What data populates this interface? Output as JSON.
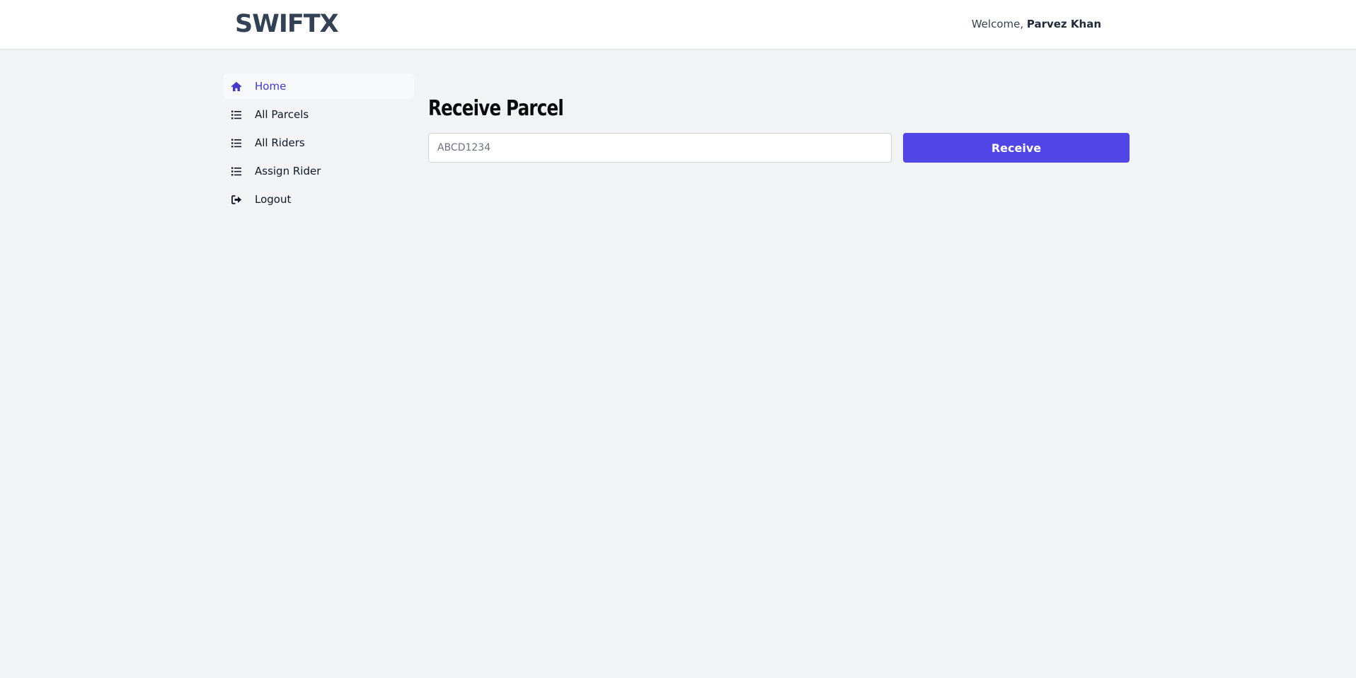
{
  "header": {
    "logo": "SWIFTX",
    "welcome_prefix": "Welcome, ",
    "user_name": "Parvez Khan"
  },
  "sidebar": {
    "items": [
      {
        "label": "Home",
        "icon": "home-icon",
        "active": true
      },
      {
        "label": "All Parcels",
        "icon": "list-icon",
        "active": false
      },
      {
        "label": "All Riders",
        "icon": "list-icon",
        "active": false
      },
      {
        "label": "Assign Rider",
        "icon": "list-icon",
        "active": false
      },
      {
        "label": "Logout",
        "icon": "logout-icon",
        "active": false
      }
    ]
  },
  "main": {
    "title": "Receive Parcel",
    "tracking_input": {
      "placeholder": "ABCD1234",
      "value": ""
    },
    "receive_button_label": "Receive"
  },
  "colors": {
    "accent": "#4f46e5",
    "active_nav_text": "#4338ca",
    "logo": "#334155",
    "page_background": "#f2f3f5"
  }
}
